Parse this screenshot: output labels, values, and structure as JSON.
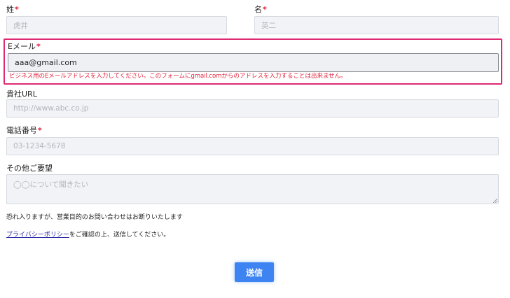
{
  "form": {
    "last_name": {
      "label": "姓",
      "required_mark": "*",
      "placeholder": "虎井"
    },
    "first_name": {
      "label": "名",
      "required_mark": "*",
      "placeholder": "英二"
    },
    "email": {
      "label": "Eメール",
      "required_mark": "*",
      "value": "aaa@gmail.com",
      "error": "ビジネス用のEメールアドレスを入力してください。このフォームにgmail.comからのアドレスを入力することは出来ません。"
    },
    "company_url": {
      "label": "貴社URL",
      "placeholder": "http://www.abc.co.jp"
    },
    "phone": {
      "label": "電話番号",
      "required_mark": "*",
      "placeholder": "03-1234-5678"
    },
    "other": {
      "label": "その他ご要望",
      "placeholder": "◯◯について聞きたい"
    },
    "notice": "恐れ入りますが、営業目的のお問い合わせはお断りいたします",
    "privacy_link": "プライバシーポリシー",
    "privacy_suffix": "をご確認の上、送信してください。",
    "submit_label": "送信"
  },
  "colors": {
    "required": "#e2263f",
    "error_border": "#df2a71",
    "submit_bg": "#3d84f2",
    "input_bg": "#f1f3f6"
  }
}
